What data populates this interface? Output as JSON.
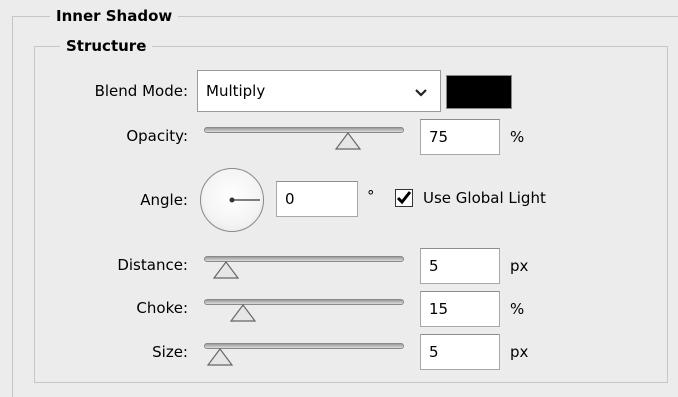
{
  "inner_shadow": {
    "title": "Inner Shadow"
  },
  "structure": {
    "title": "Structure",
    "blend_mode": {
      "label": "Blend Mode:",
      "value": "Multiply",
      "color": "#000000"
    },
    "opacity": {
      "label": "Opacity:",
      "value": "75",
      "unit": "%",
      "level": 0.75
    },
    "angle": {
      "label": "Angle:",
      "value": "0",
      "unit": "°",
      "global_light_label": "Use Global Light",
      "global_light_checked": true
    },
    "distance": {
      "label": "Distance:",
      "value": "5",
      "unit": "px",
      "level": 0.05
    },
    "choke": {
      "label": "Choke:",
      "value": "15",
      "unit": "%",
      "level": 0.15
    },
    "size": {
      "label": "Size:",
      "value": "5",
      "unit": "px",
      "level": 0.02
    }
  }
}
